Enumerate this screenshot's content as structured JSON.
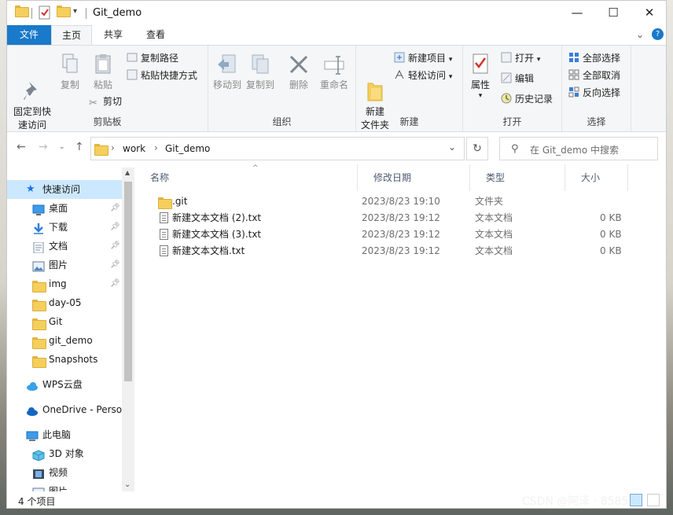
{
  "titlebar": {
    "title": "Git_demo",
    "minimize": "—",
    "maximize": "☐",
    "close": "✕"
  },
  "tabs": [
    "文件",
    "主页",
    "共享",
    "查看"
  ],
  "ribbon": {
    "clipboard": {
      "label": "剪贴板",
      "pin": "固定到快\n速访问",
      "copy": "复制",
      "paste": "粘贴",
      "copy_path": "复制路径",
      "paste_shortcut": "粘贴快捷方式",
      "cut": "剪切"
    },
    "organize": {
      "label": "组织",
      "move_to": "移动到",
      "copy_to": "复制到",
      "delete": "删除",
      "rename": "重命名"
    },
    "new": {
      "label": "新建",
      "new_folder": "新建\n文件夹",
      "new_item": "新建项目",
      "easy_access": "轻松访问"
    },
    "open": {
      "label": "打开",
      "properties": "属性",
      "open": "打开",
      "edit": "编辑",
      "history": "历史记录"
    },
    "select": {
      "label": "选择",
      "select_all": "全部选择",
      "select_none": "全部取消",
      "invert": "反向选择"
    }
  },
  "address": {
    "segments": [
      "work",
      "Git_demo"
    ],
    "search_placeholder": "在 Git_demo 中搜索"
  },
  "nav": {
    "quick_access": "快速访问",
    "items": [
      {
        "label": "桌面",
        "pinned": true
      },
      {
        "label": "下载",
        "pinned": true
      },
      {
        "label": "文档",
        "pinned": true
      },
      {
        "label": "图片",
        "pinned": true
      },
      {
        "label": "img",
        "pinned": true
      },
      {
        "label": "day-05",
        "pinned": false
      },
      {
        "label": "Git",
        "pinned": false
      },
      {
        "label": "git_demo",
        "pinned": false
      },
      {
        "label": "Snapshots",
        "pinned": false
      }
    ],
    "wps": "WPS云盘",
    "onedrive": "OneDrive - Perso",
    "this_pc": "此电脑",
    "objects3d": "3D 对象",
    "videos": "视频",
    "pictures": "图片"
  },
  "columns": [
    "名称",
    "修改日期",
    "类型",
    "大小"
  ],
  "files": [
    {
      "name": ".git",
      "date": "2023/8/23 19:10",
      "type": "文件夹",
      "size": "",
      "icon": "folder-icon"
    },
    {
      "name": "新建文本文档 (2).txt",
      "date": "2023/8/23 19:12",
      "type": "文本文档",
      "size": "0 KB",
      "icon": "text-file-icon"
    },
    {
      "name": "新建文本文档 (3).txt",
      "date": "2023/8/23 19:12",
      "type": "文本文档",
      "size": "0 KB",
      "icon": "text-file-icon"
    },
    {
      "name": "新建文本文档.txt",
      "date": "2023/8/23 19:12",
      "type": "文本文档",
      "size": "0 KB",
      "icon": "text-file-icon"
    }
  ],
  "status": {
    "item_count": "4 个项目"
  },
  "watermark": "CSDN @阿泽 · 8585"
}
